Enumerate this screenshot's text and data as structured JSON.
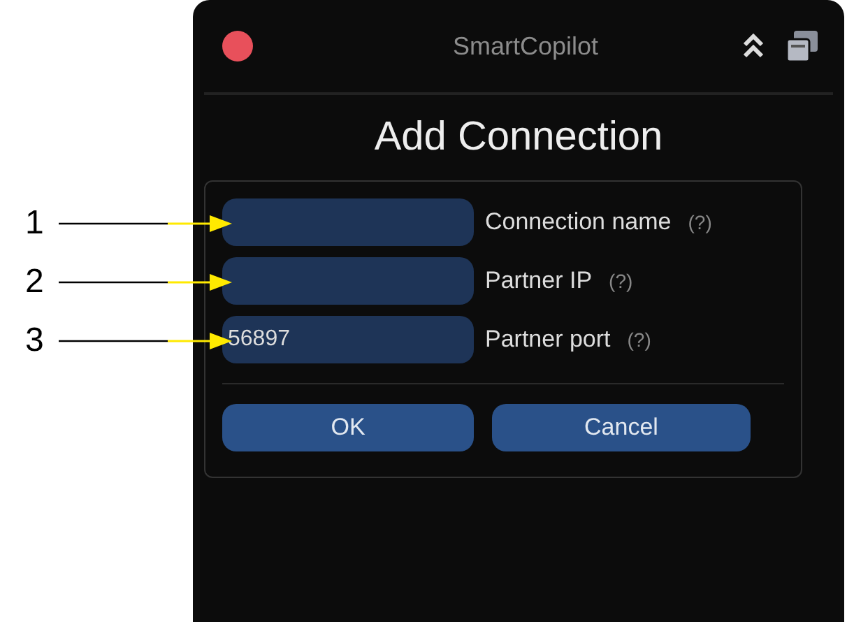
{
  "callouts": [
    {
      "label": "1"
    },
    {
      "label": "2"
    },
    {
      "label": "3"
    }
  ],
  "window": {
    "title": "SmartCopilot"
  },
  "dialog": {
    "heading": "Add Connection",
    "fields": [
      {
        "label": "Connection name",
        "help": "(?)"
      },
      {
        "label": "Partner IP",
        "help": "(?)"
      },
      {
        "label": "Partner port",
        "help": "(?)",
        "value": "56897"
      }
    ],
    "buttons": [
      "OK",
      "Cancel"
    ]
  }
}
